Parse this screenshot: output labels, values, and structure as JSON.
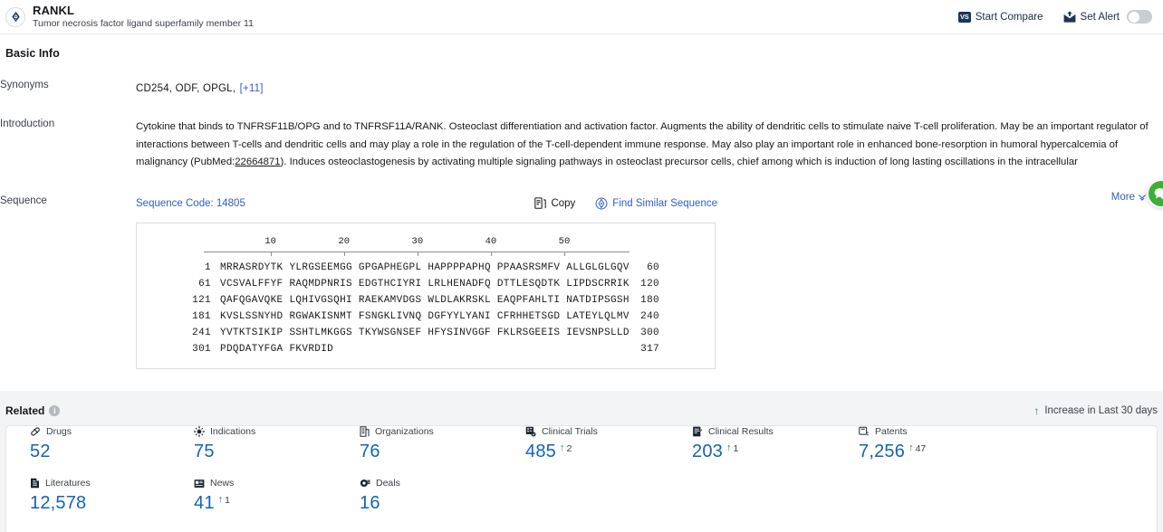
{
  "header": {
    "logo_icon": "target-diamond-icon",
    "title": "RANKL",
    "subtitle": "Tumor necrosis factor ligand superfamily member 11",
    "actions": [
      {
        "icon": "vs-compare-icon",
        "label": "Start Compare"
      },
      {
        "icon": "alert-bell-icon",
        "label": "Set Alert"
      }
    ],
    "toggle_on": false
  },
  "basic_info": {
    "section_title": "Basic Info",
    "synonyms": {
      "label": "Synonyms",
      "value": "CD254, ODF, OPGL,",
      "more": "[+11]"
    },
    "introduction": {
      "label": "Introduction",
      "line1_a": "Cytokine that binds to TNFRSF11B/OPG and to TNFRSF11A/RANK. Osteoclast differentiation and activation factor. Augments the ability of dendritic cells to stimulate naive T-cell proliferation. May be an important regulator of interactions between T-cells and dendritic cells and may play a role in the regulation of the T-cell-dependent immune response. May also play an important role in enhanced bone-resorption in humoral hypercalcemia of malignancy (PubMed:",
      "pubmed_id": "22664871",
      "line1_b": "). Induces osteoclastogenesis by activating multiple signaling pathways in osteoclast precursor cells, chief among which is induction of long lasting oscillations in the intracellular",
      "more_label": "More"
    },
    "sequence": {
      "label": "Sequence",
      "code_label": "Sequence Code: 14805",
      "copy_label": "Copy",
      "find_similar_label": "Find Similar Sequence",
      "ruler_ticks": [
        10,
        20,
        30,
        40,
        50
      ],
      "lines": [
        {
          "start": "1",
          "body": "MRRASRDYTK YLRGSEEMGG GPGAPHEGPL HAPPPPAPHQ PPAASRSMFV ALLGLGLGQV",
          "end": "60"
        },
        {
          "start": "61",
          "body": "VCSVALFFYF RAQMDPNRIS EDGTHCIYRI LRLHENADFQ DTTLESQDTK LIPDSCRRIK",
          "end": "120"
        },
        {
          "start": "121",
          "body": "QAFQGAVQKE LQHIVGSQHI RAEKAMVDGS WLDLAKRSKL EAQPFAHLTI NATDIPSGSH",
          "end": "180"
        },
        {
          "start": "181",
          "body": "KVSLSSNYHD RGWAKISNMT FSNGKLIVNQ DGFYYLYANI CFRHHETSGD LATEYLQLMV",
          "end": "240"
        },
        {
          "start": "241",
          "body": "YVTKTSIKIP SSHTLMKGGS TKYWSGNSEF HFYSINVGGF FKLRSGEEIS IEVSNPSLLD",
          "end": "300"
        },
        {
          "start": "301",
          "body": "PDQDATYFGA FKVRDID",
          "end": "317"
        }
      ]
    }
  },
  "related": {
    "title": "Related",
    "info_icon": "info-icon",
    "legend": {
      "arrow_icon": "up-arrow-icon",
      "text": "Increase in Last 30 days"
    },
    "stats": [
      {
        "icon": "pill-icon",
        "label": "Drugs",
        "value": "52",
        "delta": ""
      },
      {
        "icon": "virus-icon",
        "label": "Indications",
        "value": "75",
        "delta": ""
      },
      {
        "icon": "building-icon",
        "label": "Organizations",
        "value": "76",
        "delta": ""
      },
      {
        "icon": "clinical-trials-icon",
        "label": "Clinical Trials",
        "value": "485",
        "delta": "2"
      },
      {
        "icon": "clinical-results-icon",
        "label": "Clinical Results",
        "value": "203",
        "delta": "1"
      },
      {
        "icon": "patent-icon",
        "label": "Patents",
        "value": "7,256",
        "delta": "47"
      },
      {
        "icon": "literature-icon",
        "label": "Literatures",
        "value": "12,578",
        "delta": ""
      },
      {
        "icon": "news-icon",
        "label": "News",
        "value": "41",
        "delta": "1"
      },
      {
        "icon": "deals-icon",
        "label": "Deals",
        "value": "16",
        "delta": ""
      }
    ]
  },
  "floating": {
    "icon": "chat-bubble-icon",
    "color": "#3cb034"
  },
  "colors": {
    "link": "#2f5fc4",
    "stat_number": "#1263b8",
    "increase": "#1f8a3b",
    "header_dark": "#1d3557"
  }
}
